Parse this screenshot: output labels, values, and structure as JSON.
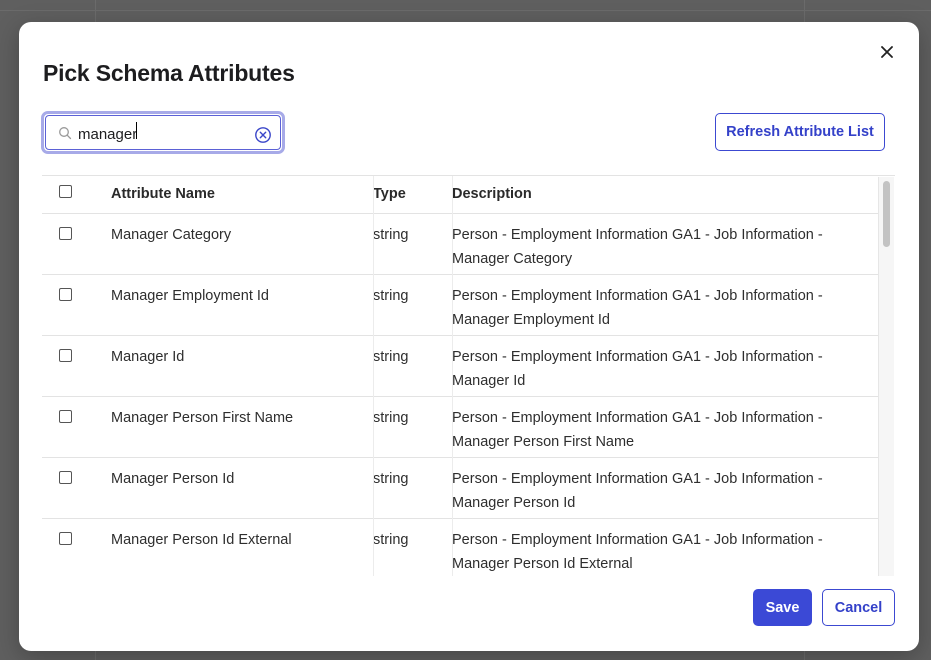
{
  "dialog": {
    "title": "Pick Schema Attributes",
    "close_icon": "close-icon"
  },
  "search": {
    "value": "manager",
    "icon": "search-icon",
    "clear_icon": "clear-circle-x-icon"
  },
  "refresh_label": "Refresh Attribute List",
  "table": {
    "headers": {
      "name": "Attribute Name",
      "type": "Type",
      "description": "Description"
    },
    "rows": [
      {
        "name": "Manager Category",
        "type": "string",
        "desc_line1": "Person - Employment Information GA1 - Job Information -",
        "desc_line2": "Manager Category"
      },
      {
        "name": "Manager Employment Id",
        "type": "string",
        "desc_line1": "Person - Employment Information GA1 - Job Information -",
        "desc_line2": "Manager Employment Id"
      },
      {
        "name": "Manager Id",
        "type": "string",
        "desc_line1": "Person - Employment Information GA1 - Job Information -",
        "desc_line2": "Manager Id"
      },
      {
        "name": "Manager Person First Name",
        "type": "string",
        "desc_line1": "Person - Employment Information GA1 - Job Information -",
        "desc_line2": "Manager Person First Name"
      },
      {
        "name": "Manager Person Id",
        "type": "string",
        "desc_line1": "Person - Employment Information GA1 - Job Information -",
        "desc_line2": "Manager Person Id"
      },
      {
        "name": "Manager Person Id External",
        "type": "string",
        "desc_line1": "Person - Employment Information GA1 - Job Information -",
        "desc_line2": "Manager Person Id External"
      }
    ]
  },
  "footer": {
    "save_label": "Save",
    "cancel_label": "Cancel"
  },
  "colors": {
    "primary": "#3b49d6",
    "focus_ring": "#a7aae8",
    "backdrop": "#5f5f5f"
  }
}
